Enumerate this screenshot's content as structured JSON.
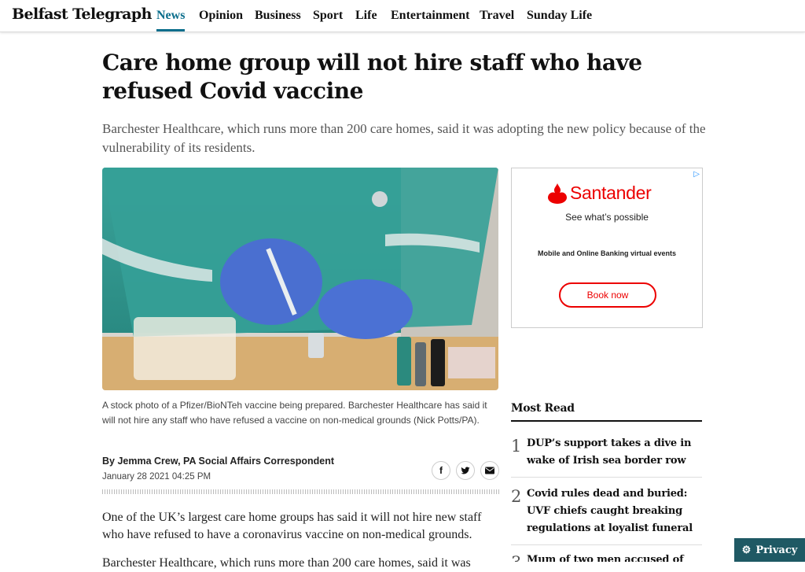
{
  "header": {
    "brand": "Belfast Telegraph",
    "nav": [
      {
        "label": "News",
        "active": true
      },
      {
        "label": "Opinion"
      },
      {
        "label": "Business"
      },
      {
        "label": "Sport"
      },
      {
        "label": "Life"
      },
      {
        "label": "Entertainment"
      },
      {
        "label": "Travel"
      },
      {
        "label": "Sunday Life"
      }
    ]
  },
  "article": {
    "headline": "Care home group will not hire staff who have refused Covid vaccine",
    "standfirst": "Barchester Healthcare, which runs more than 200 care homes, said it was adopting the new policy because of the vulnerability of its residents.",
    "caption": "A stock photo of a Pfizer/BioNTeh vaccine being prepared. Barchester Healthcare has said it will not hire any staff who have refused a vaccine on non-medical grounds (Nick Potts/PA).",
    "byline": "By Jemma Crew, PA Social Affairs Correspondent",
    "date": "January 28 2021 04:25 PM",
    "share_icons": [
      "facebook-icon",
      "twitter-icon",
      "email-icon"
    ],
    "body": [
      "One of the UK’s largest care home groups has said it will not hire new staff who have refused to have a coronavirus vaccine on non-medical grounds.",
      "Barchester Healthcare, which runs more than 200 care homes, said it was"
    ]
  },
  "ad": {
    "brand": "Santander",
    "tagline": "See what’s possible",
    "events": "Mobile and Online Banking virtual events",
    "button": "Book now",
    "brand_color": "#ec0000"
  },
  "most_read": {
    "title": "Most Read",
    "items": [
      {
        "num": "1",
        "title": "DUP’s support takes a dive in wake of Irish sea border row"
      },
      {
        "num": "2",
        "title": "Covid rules dead and buried: UVF chiefs caught breaking regulations at loyalist funeral"
      },
      {
        "num": "3",
        "title": "Mum of two men accused of taking"
      }
    ]
  },
  "privacy": {
    "label": "Privacy"
  },
  "colors": {
    "accent": "#0b6e8c",
    "privacy_bg": "#1f5964"
  }
}
